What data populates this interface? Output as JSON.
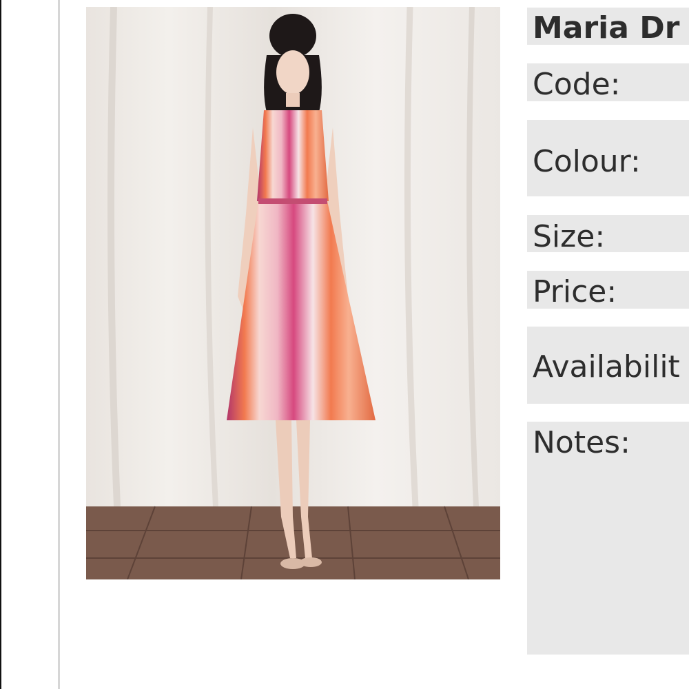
{
  "product": {
    "title": "Maria Dr",
    "image_icon": "product-photo-dress"
  },
  "details": {
    "code_label": "Code:",
    "colour_label": "Colour:",
    "size_label": "Size:",
    "price_label": "Price:",
    "availability_label": "Availabilit",
    "notes_label": "Notes:"
  },
  "colors": {
    "panel_bg": "#e8e8e8",
    "text": "#2d2d2d",
    "dress_orange": "#f27a4f",
    "dress_pink": "#d6487e",
    "floor": "#7a5a4c"
  }
}
